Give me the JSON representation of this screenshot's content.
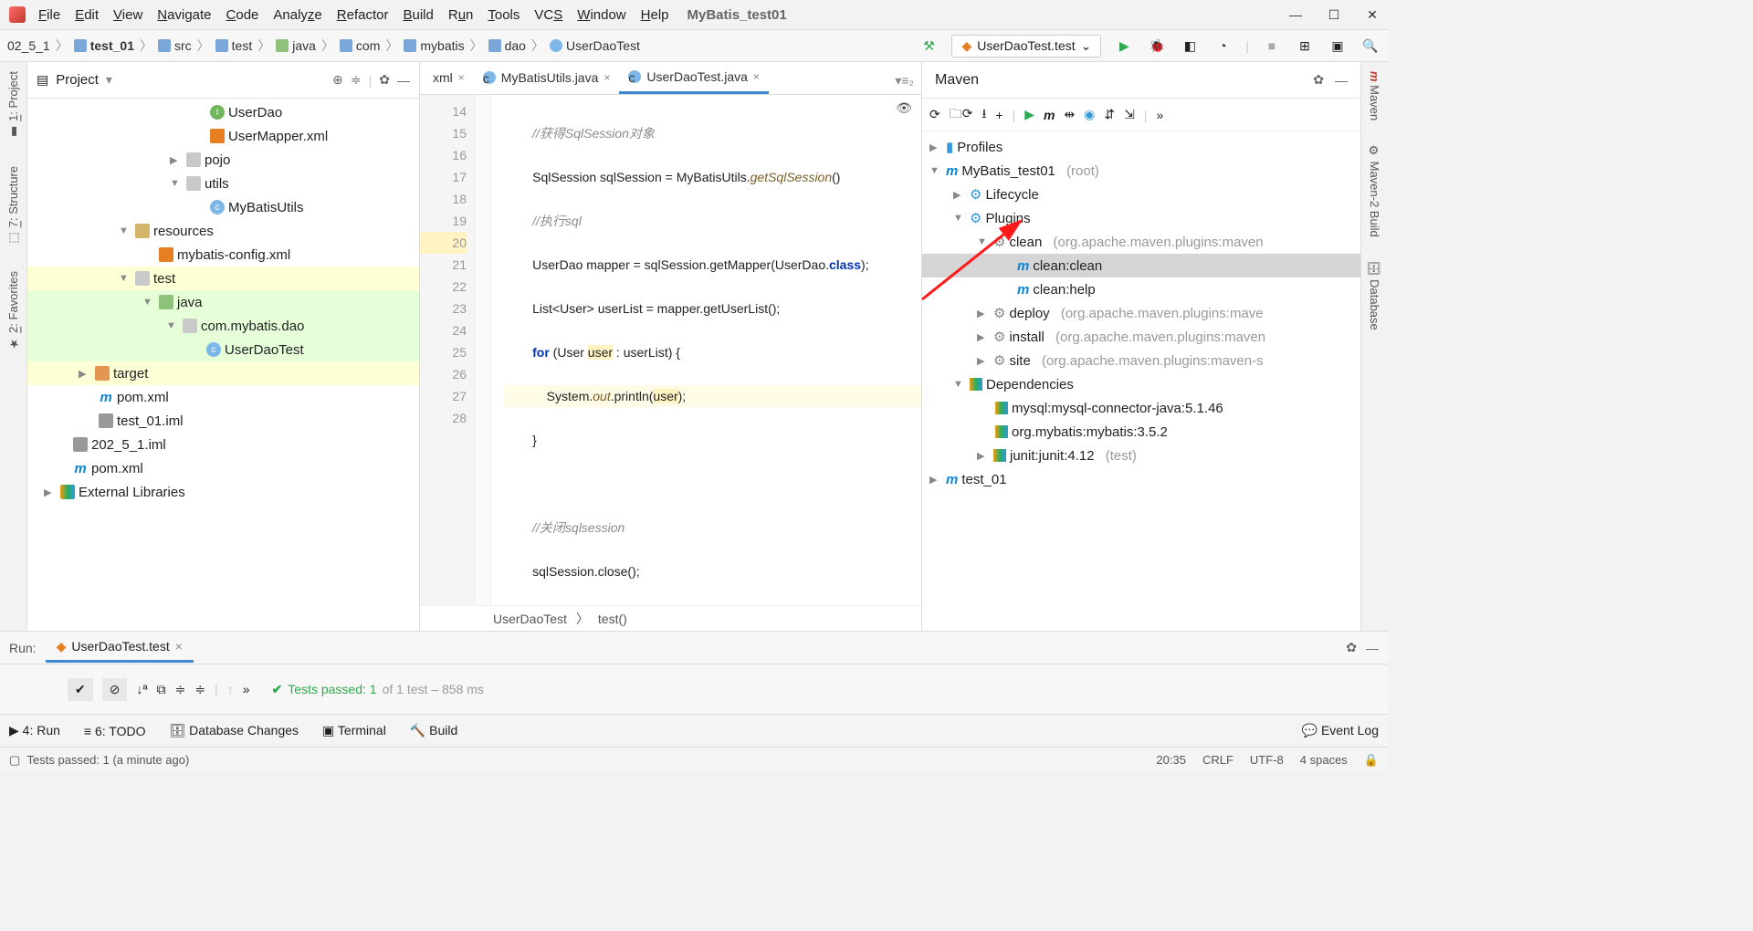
{
  "title": "MyBatis_test01",
  "menu": [
    "File",
    "Edit",
    "View",
    "Navigate",
    "Code",
    "Analyze",
    "Refactor",
    "Build",
    "Run",
    "Tools",
    "VCS",
    "Window",
    "Help"
  ],
  "breadcrumbs": [
    "02_5_1",
    "test_01",
    "src",
    "test",
    "java",
    "com",
    "mybatis",
    "dao",
    "UserDaoTest"
  ],
  "run_config": "UserDaoTest.test",
  "project_panel": {
    "title": "Project"
  },
  "tree": {
    "userdao": "UserDao",
    "usermapper": "UserMapper.xml",
    "pojo": "pojo",
    "utils": "utils",
    "mybatisutils": "MyBatisUtils",
    "resources": "resources",
    "mybatisconfig": "mybatis-config.xml",
    "test": "test",
    "java": "java",
    "pkg": "com.mybatis.dao",
    "userdaotest": "UserDaoTest",
    "target": "target",
    "pom1": "pom.xml",
    "iml1": "test_01.iml",
    "iml2": "202_5_1.iml",
    "pom2": "pom.xml",
    "extlib": "External Libraries"
  },
  "tabs": {
    "t0": "xml",
    "t1": "MyBatisUtils.java",
    "t2": "UserDaoTest.java"
  },
  "code": {
    "l14": "//获得SqlSession对象",
    "l15a": "SqlSession sqlSession = MyBatisUtils.",
    "l15b": "getSqlSession",
    "l15c": "()",
    "l16": "//执行sql",
    "l17a": "UserDao mapper = sqlSession.getMapper(UserDao.",
    "l17b": "class",
    "l17c": ");",
    "l18": "List<User> userList = mapper.getUserList();",
    "l19a": "for",
    "l19b": " (User ",
    "l19c": "user",
    "l19d": " : userList) {",
    "l20a": "    System.",
    "l20b": "out",
    "l20c": ".println(",
    "l20d": "user",
    "l20e": ");",
    "l21": "}",
    "l23": "//关闭sqlsession",
    "l24": "sqlSession.close();"
  },
  "lines": [
    "14",
    "15",
    "16",
    "17",
    "18",
    "19",
    "20",
    "21",
    "22",
    "23",
    "24",
    "25",
    "26",
    "27",
    "28"
  ],
  "editor_breadcrumb": {
    "cls": "UserDaoTest",
    "method": "test()"
  },
  "maven": {
    "title": "Maven",
    "profiles": "Profiles",
    "root": "MyBatis_test01",
    "root_suffix": "(root)",
    "lifecycle": "Lifecycle",
    "plugins": "Plugins",
    "clean": "clean",
    "clean_suffix": "(org.apache.maven.plugins:maven",
    "clean_clean": "clean:clean",
    "clean_help": "clean:help",
    "deploy": "deploy",
    "deploy_suffix": "(org.apache.maven.plugins:mave",
    "install": "install",
    "install_suffix": "(org.apache.maven.plugins:maven",
    "site": "site",
    "site_suffix": "(org.apache.maven.plugins:maven-s",
    "deps": "Dependencies",
    "dep1": "mysql:mysql-connector-java:5.1.46",
    "dep2": "org.mybatis:mybatis:3.5.2",
    "dep3": "junit:junit:4.12",
    "dep3_suffix": "(test)",
    "test01": "test_01"
  },
  "run": {
    "label": "Run:",
    "tab": "UserDaoTest.test",
    "result_prefix": "Tests passed: 1",
    "result_suffix": " of 1 test – 858 ms"
  },
  "bottom1": {
    "run": "4: Run",
    "todo": "6: TODO",
    "db": "Database Changes",
    "terminal": "Terminal",
    "build": "Build",
    "eventlog": "Event Log"
  },
  "status": {
    "msg": "Tests passed: 1 (a minute ago)",
    "time": "20:35",
    "eol": "CRLF",
    "enc": "UTF-8",
    "indent": "4 spaces"
  }
}
